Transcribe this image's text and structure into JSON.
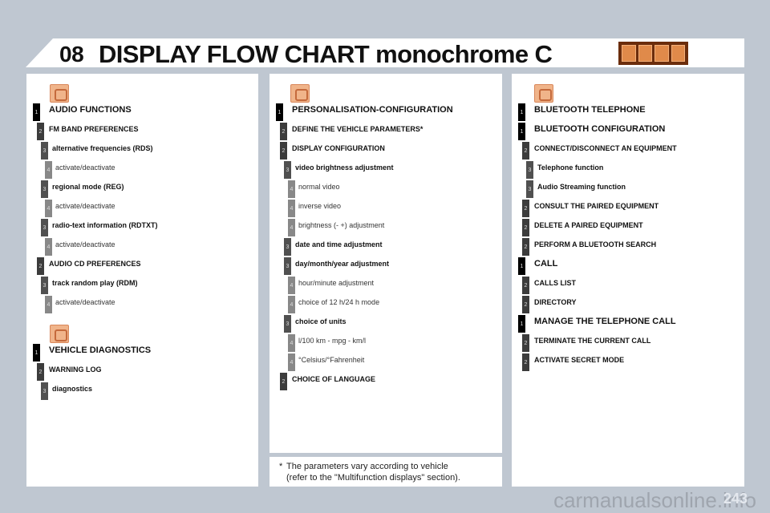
{
  "header": {
    "chapter": "08",
    "title": "DISPLAY FLOW CHART monochrome C"
  },
  "columns": [
    {
      "groups": [
        {
          "icon": "audio-icon",
          "items": [
            {
              "level": 1,
              "text": "AUDIO FUNCTIONS"
            },
            {
              "level": 2,
              "text": "FM BAND PREFERENCES"
            },
            {
              "level": 3,
              "text": "alternative frequencies (RDS)"
            },
            {
              "level": 4,
              "text": "activate/deactivate"
            },
            {
              "level": 3,
              "text": "regional mode (REG)"
            },
            {
              "level": 4,
              "text": "activate/deactivate"
            },
            {
              "level": 3,
              "text": "radio-text information (RDTXT)"
            },
            {
              "level": 4,
              "text": "activate/deactivate"
            },
            {
              "level": 2,
              "text": "AUDIO CD PREFERENCES"
            },
            {
              "level": 3,
              "text": "track random play (RDM)"
            },
            {
              "level": 4,
              "text": "activate/deactivate"
            }
          ]
        },
        {
          "icon": "vehicle-diagnostics-icon",
          "items": [
            {
              "level": 1,
              "text": "VEHICLE DIAGNOSTICS"
            },
            {
              "level": 2,
              "text": "WARNING LOG"
            },
            {
              "level": 3,
              "text": "diagnostics"
            }
          ]
        }
      ]
    },
    {
      "groups": [
        {
          "icon": "settings-icon",
          "items": [
            {
              "level": 1,
              "text": "PERSONALISATION-CONFIGURATION"
            },
            {
              "level": 2,
              "text": "DEFINE THE VEHICLE PARAMETERS*"
            },
            {
              "level": 2,
              "text": "DISPLAY CONFIGURATION"
            },
            {
              "level": 3,
              "text": "video brightness adjustment"
            },
            {
              "level": 4,
              "text": "normal video"
            },
            {
              "level": 4,
              "text": "inverse video"
            },
            {
              "level": 4,
              "text": "brightness (- +) adjustment"
            },
            {
              "level": 3,
              "text": "date and time adjustment"
            },
            {
              "level": 3,
              "text": "day/month/year adjustment"
            },
            {
              "level": 4,
              "text": "hour/minute adjustment"
            },
            {
              "level": 4,
              "text": "choice of 12 h/24 h mode"
            },
            {
              "level": 3,
              "text": "choice of units"
            },
            {
              "level": 4,
              "text": "l/100 km - mpg - km/l"
            },
            {
              "level": 4,
              "text": "°Celsius/°Fahrenheit"
            },
            {
              "level": 2,
              "text": "CHOICE OF LANGUAGE"
            }
          ]
        }
      ]
    },
    {
      "groups": [
        {
          "icon": "telephone-icon",
          "items": [
            {
              "level": 1,
              "text": "BLUETOOTH TELEPHONE"
            },
            {
              "level": 1,
              "text": "BLUETOOTH CONFIGURATION"
            },
            {
              "level": 2,
              "text": "CONNECT/DISCONNECT AN EQUIPMENT"
            },
            {
              "level": 3,
              "text": "Telephone function"
            },
            {
              "level": 3,
              "text": "Audio Streaming function"
            },
            {
              "level": 2,
              "text": "CONSULT THE PAIRED EQUIPMENT"
            },
            {
              "level": 2,
              "text": "DELETE A PAIRED EQUIPMENT"
            },
            {
              "level": 2,
              "text": "PERFORM A BLUETOOTH SEARCH"
            },
            {
              "level": 1,
              "text": "CALL"
            },
            {
              "level": 2,
              "text": "CALLS LIST"
            },
            {
              "level": 2,
              "text": "DIRECTORY"
            },
            {
              "level": 1,
              "text": "MANAGE THE TELEPHONE CALL"
            },
            {
              "level": 2,
              "text": "TERMINATE THE CURRENT CALL"
            },
            {
              "level": 2,
              "text": "ACTIVATE SECRET MODE"
            }
          ]
        }
      ]
    }
  ],
  "footnote": {
    "star": "*",
    "line1": "The parameters vary according to vehicle",
    "line2": "(refer to the \"Multifunction displays\" section)."
  },
  "page_number": "243",
  "watermark": "carmanualsonline.info"
}
